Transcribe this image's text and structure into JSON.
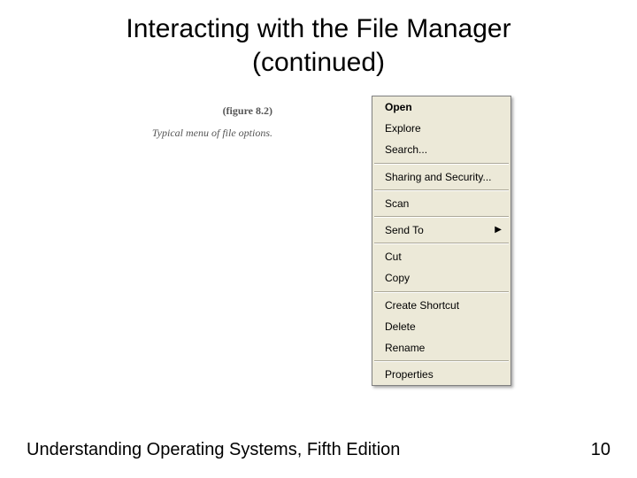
{
  "title_line1": "Interacting with the File Manager",
  "title_line2": "(continued)",
  "caption": {
    "label": "(figure 8.2)",
    "desc": "Typical menu of file options."
  },
  "menu": {
    "open": "Open",
    "explore": "Explore",
    "search": "Search...",
    "sharing": "Sharing and Security...",
    "scan": "Scan",
    "sendto": "Send To",
    "cut": "Cut",
    "copy": "Copy",
    "shortcut": "Create Shortcut",
    "delete": "Delete",
    "rename": "Rename",
    "properties": "Properties"
  },
  "footer": {
    "book": "Understanding Operating Systems, Fifth Edition",
    "page": "10"
  }
}
